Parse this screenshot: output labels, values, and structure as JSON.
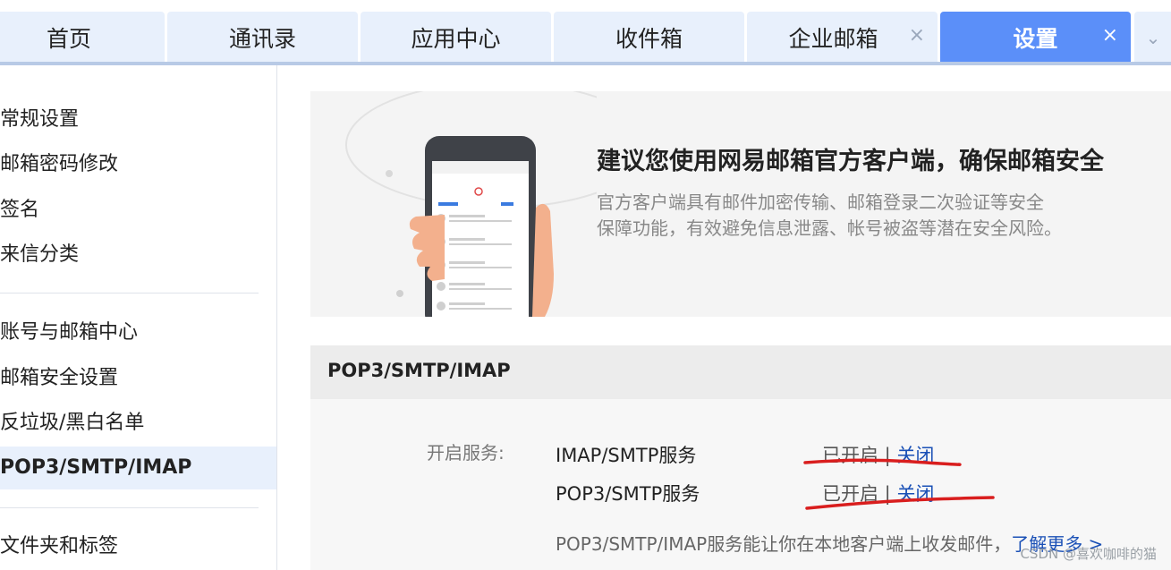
{
  "tabs": [
    {
      "label": "首页",
      "closable": false,
      "active": false
    },
    {
      "label": "通讯录",
      "closable": false,
      "active": false
    },
    {
      "label": "应用中心",
      "closable": false,
      "active": false
    },
    {
      "label": "收件箱",
      "closable": false,
      "active": false
    },
    {
      "label": "企业邮箱",
      "closable": true,
      "active": false
    },
    {
      "label": "设置",
      "closable": true,
      "active": true
    }
  ],
  "tab_close_glyph": "×",
  "tab_more_glyph": "⌄",
  "sidebar": {
    "items": [
      {
        "label": "常规设置"
      },
      {
        "label": "邮箱密码修改"
      },
      {
        "label": "签名"
      },
      {
        "label": "来信分类"
      },
      {
        "label": "账号与邮箱中心"
      },
      {
        "label": "邮箱安全设置"
      },
      {
        "label": "反垃圾/黑白名单"
      },
      {
        "label": "POP3/SMTP/IMAP",
        "active": true
      },
      {
        "label": "文件夹和标签"
      }
    ]
  },
  "banner": {
    "title": "建议您使用网易邮箱官方客户端，确保邮箱安全",
    "desc_line1": "官方客户端具有邮件加密传输、邮箱登录二次验证等安全",
    "desc_line2": "保障功能，有效避免信息泄露、帐号被盗等潜在安全风险。"
  },
  "panel": {
    "title": "POP3/SMTP/IMAP",
    "open_label": "开启服务:",
    "services": [
      {
        "name": "IMAP/SMTP服务",
        "status": "已开启",
        "sep": " | ",
        "action": "关闭"
      },
      {
        "name": "POP3/SMTP服务",
        "status": "已开启",
        "sep": " | ",
        "action": "关闭"
      }
    ],
    "description": "POP3/SMTP/IMAP服务能让你在本地客户端上收发邮件，",
    "learn_more": "了解更多 >"
  },
  "watermark": "CSDN @喜欢咖啡的猫",
  "colors": {
    "accent": "#5b8ff9",
    "tab_bg": "#e8f0fc",
    "link": "#1a50b6",
    "annotation": "#d91e1e"
  }
}
